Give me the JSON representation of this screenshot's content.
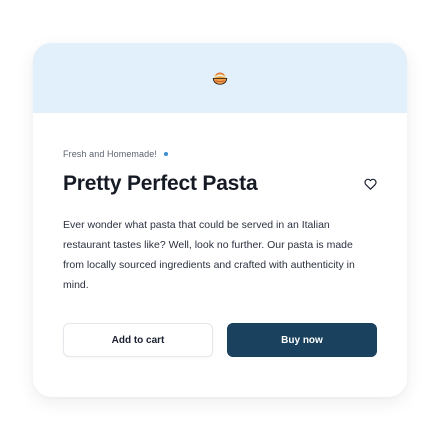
{
  "card": {
    "hero_icon": "pasta-bowl-icon",
    "tagline": "Fresh and Homemade!",
    "title": "Pretty Perfect Pasta",
    "favorite_icon": "heart-icon",
    "description": "Ever wonder what pasta that could be served in an Italian restaurant tastes like? Well, look no further. Our pasta is made from locally sourced ingredients and crafted with authenticity in mind.",
    "actions": {
      "add_to_cart_label": "Add to cart",
      "buy_now_label": "Buy now"
    }
  },
  "colors": {
    "hero_background": "#e1f0fb",
    "primary_button": "#1a425e",
    "tag_dot": "#3c8fd0",
    "title_text": "#151a24"
  }
}
